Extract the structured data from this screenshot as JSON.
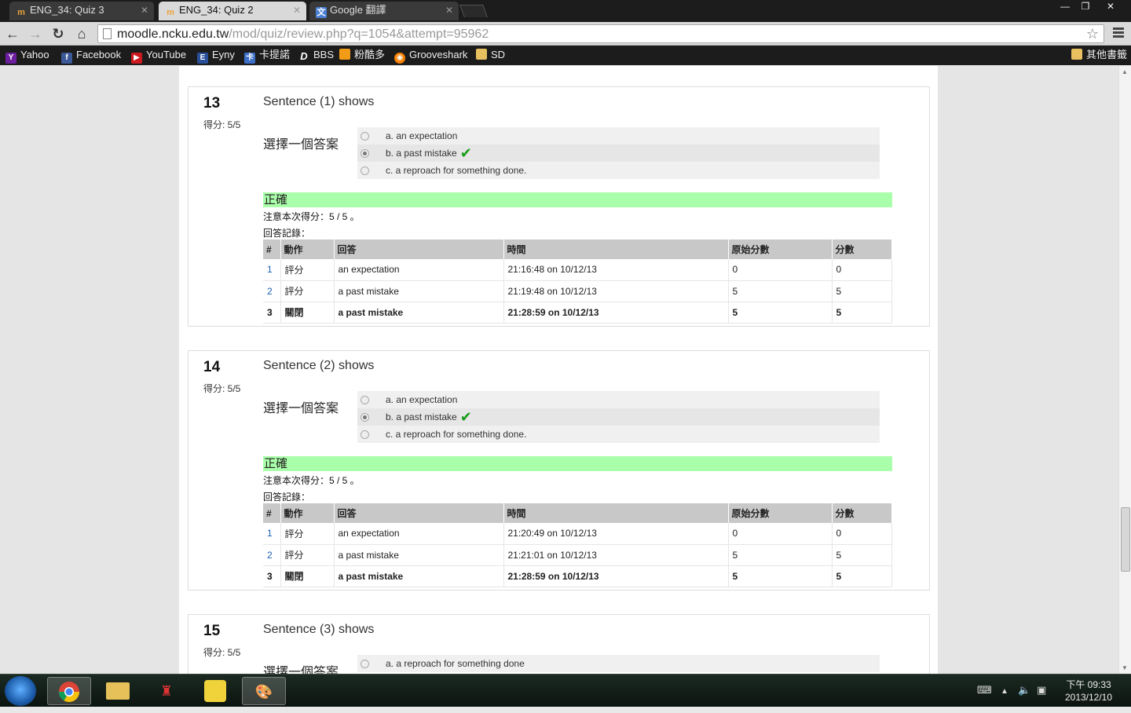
{
  "tabs": [
    {
      "title": "ENG_34: Quiz 3",
      "icon": "moodle-icon",
      "active": false
    },
    {
      "title": "ENG_34: Quiz 2",
      "icon": "moodle-icon",
      "active": true
    },
    {
      "title": "Google 翻譯",
      "icon": "google-translate-icon",
      "active": false
    }
  ],
  "window_controls": {
    "minimize": "—",
    "restore": "❐",
    "close": "✕"
  },
  "address_bar": {
    "host": "moodle.ncku.edu.tw",
    "path": "/mod/quiz/review.php?q=1054&attempt=95962"
  },
  "bookmarks": [
    "Yahoo",
    "Facebook",
    "YouTube",
    "Eyny",
    "卡提諾",
    "BBS",
    "粉酷多",
    "Grooveshark",
    "SD"
  ],
  "bookmarks_other": "其他書籤",
  "questions": [
    {
      "number": "13",
      "grade": "得分: 5/5",
      "text": "Sentence (1) shows",
      "prompt": "選擇一個答案",
      "options": [
        "a. an expectation",
        "b. a past mistake",
        "c. a reproach for something done."
      ],
      "selected": 1,
      "state": "正確",
      "mark_note": "注意本次得分：5 / 5 。",
      "history_label": "回答記錄：",
      "history_headers": [
        "#",
        "動作",
        "回答",
        "時間",
        "原始分數",
        "分數"
      ],
      "history": [
        [
          "1",
          "評分",
          "an expectation",
          "21:16:48 on 10/12/13",
          "0",
          "0"
        ],
        [
          "2",
          "評分",
          "a past mistake",
          "21:19:48 on 10/12/13",
          "5",
          "5"
        ],
        [
          "3",
          "關閉",
          "a past mistake",
          "21:28:59 on 10/12/13",
          "5",
          "5"
        ]
      ]
    },
    {
      "number": "14",
      "grade": "得分: 5/5",
      "text": "Sentence (2) shows",
      "prompt": "選擇一個答案",
      "options": [
        "a. an expectation",
        "b. a past mistake",
        "c. a reproach for something done."
      ],
      "selected": 1,
      "state": "正確",
      "mark_note": "注意本次得分：5 / 5 。",
      "history_label": "回答記錄：",
      "history_headers": [
        "#",
        "動作",
        "回答",
        "時間",
        "原始分數",
        "分數"
      ],
      "history": [
        [
          "1",
          "評分",
          "an expectation",
          "21:20:49 on 10/12/13",
          "0",
          "0"
        ],
        [
          "2",
          "評分",
          "a past mistake",
          "21:21:01 on 10/12/13",
          "5",
          "5"
        ],
        [
          "3",
          "關閉",
          "a past mistake",
          "21:28:59 on 10/12/13",
          "5",
          "5"
        ]
      ]
    },
    {
      "number": "15",
      "grade": "得分: 5/5",
      "text": "Sentence (3) shows",
      "prompt": "選擇一個答案",
      "options": [
        "a. a reproach for something done"
      ]
    }
  ],
  "taskbar": {
    "apps": [
      "chrome-icon",
      "file-explorer-icon",
      "gundam-game-icon",
      "yellow-app-icon",
      "paint-icon"
    ],
    "clock_time": "下午 09:33",
    "clock_date": "2013/12/10"
  },
  "colors": {
    "correct_bg": "#aaffaa",
    "tick": "#1a9c1a",
    "link": "#1a5fb4"
  }
}
